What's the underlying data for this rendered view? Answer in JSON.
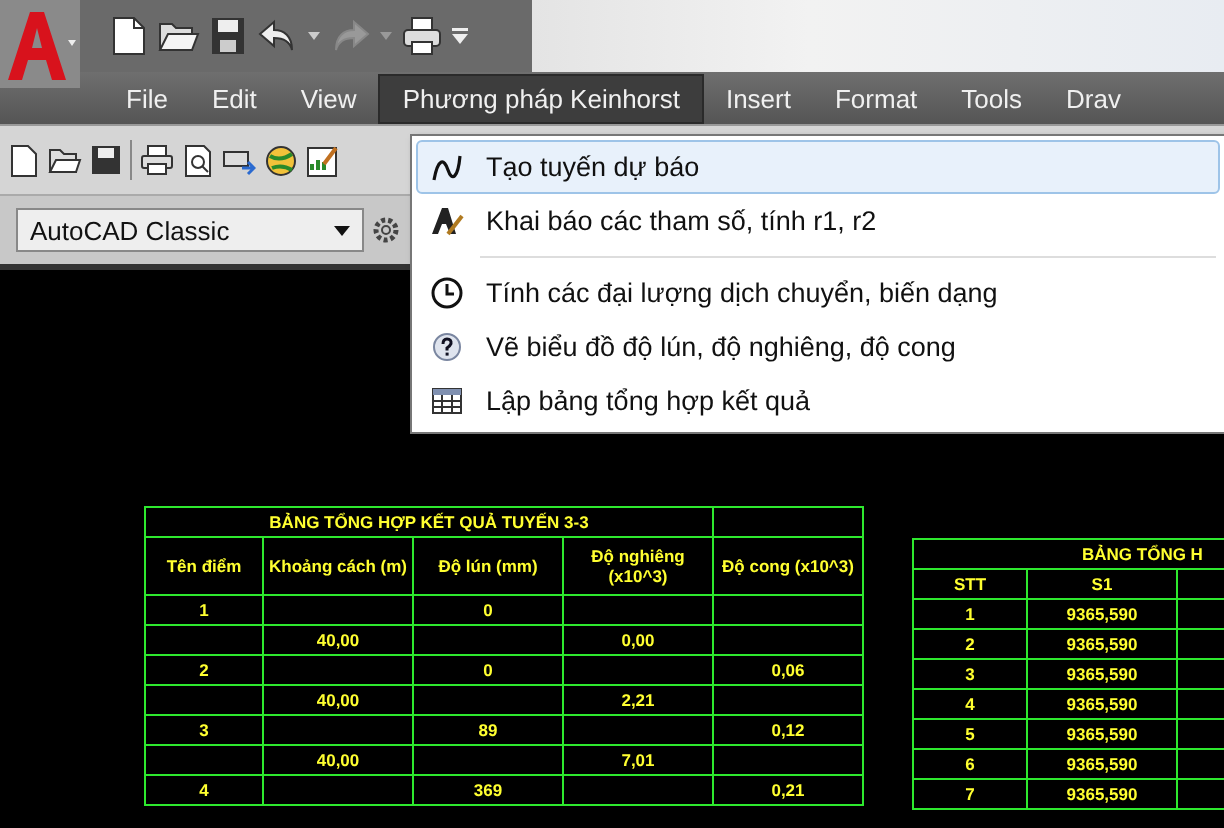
{
  "menu_bar": [
    {
      "label": "File",
      "selected": false
    },
    {
      "label": "Edit",
      "selected": false
    },
    {
      "label": "View",
      "selected": false
    },
    {
      "label": "Phương pháp Keinhorst",
      "selected": true
    },
    {
      "label": "Insert",
      "selected": false
    },
    {
      "label": "Format",
      "selected": false
    },
    {
      "label": "Tools",
      "selected": false
    },
    {
      "label": "Drav",
      "selected": false
    }
  ],
  "dropdown": [
    {
      "label": "Tạo tuyến dự báo",
      "kind": "curve",
      "selected": true,
      "separator_before": false
    },
    {
      "label": "Khai báo các tham số, tính r1, r2",
      "kind": "text-style",
      "selected": false,
      "separator_before": false
    },
    {
      "label": "Tính các đại lượng dịch chuyển, biến dạng",
      "kind": "clock",
      "selected": false,
      "separator_before": true
    },
    {
      "label": "Vẽ biểu đồ độ lún, độ nghiêng, độ cong",
      "kind": "help",
      "selected": false,
      "separator_before": false
    },
    {
      "label": "Lập bảng tổng hợp kết quả",
      "kind": "table",
      "selected": false,
      "separator_before": false
    }
  ],
  "workspace": {
    "value": "AutoCAD Classic"
  },
  "tables": [
    {
      "title": "BẢNG TỔNG HỢP KẾT QUẢ TUYẾN 3-3",
      "extra_column": false,
      "columns": [
        "Tên điểm",
        "Khoảng cách (m)",
        "Độ lún (mm)",
        "Độ nghiêng (x10^3)",
        "Độ cong (x10^3)"
      ],
      "rows": [
        [
          "1",
          null,
          "0",
          null,
          null
        ],
        [
          null,
          "40,00",
          null,
          "0,00",
          null
        ],
        [
          "2",
          null,
          "0",
          null,
          "0,06"
        ],
        [
          null,
          "40,00",
          null,
          "2,21",
          null
        ],
        [
          "3",
          null,
          "89",
          null,
          "0,12"
        ],
        [
          null,
          "40,00",
          null,
          "7,01",
          null
        ],
        [
          "4",
          null,
          "369",
          null,
          "0,21"
        ]
      ]
    },
    {
      "title": "BẢNG TỔNG H",
      "extra_column": true,
      "columns": [
        "STT",
        "S1"
      ],
      "rows": [
        [
          "1",
          "9365,590"
        ],
        [
          "2",
          "9365,590"
        ],
        [
          "3",
          "9365,590"
        ],
        [
          "4",
          "9365,590"
        ],
        [
          "5",
          "9365,590"
        ],
        [
          "6",
          "9365,590"
        ],
        [
          "7",
          "9365,590"
        ]
      ]
    }
  ]
}
